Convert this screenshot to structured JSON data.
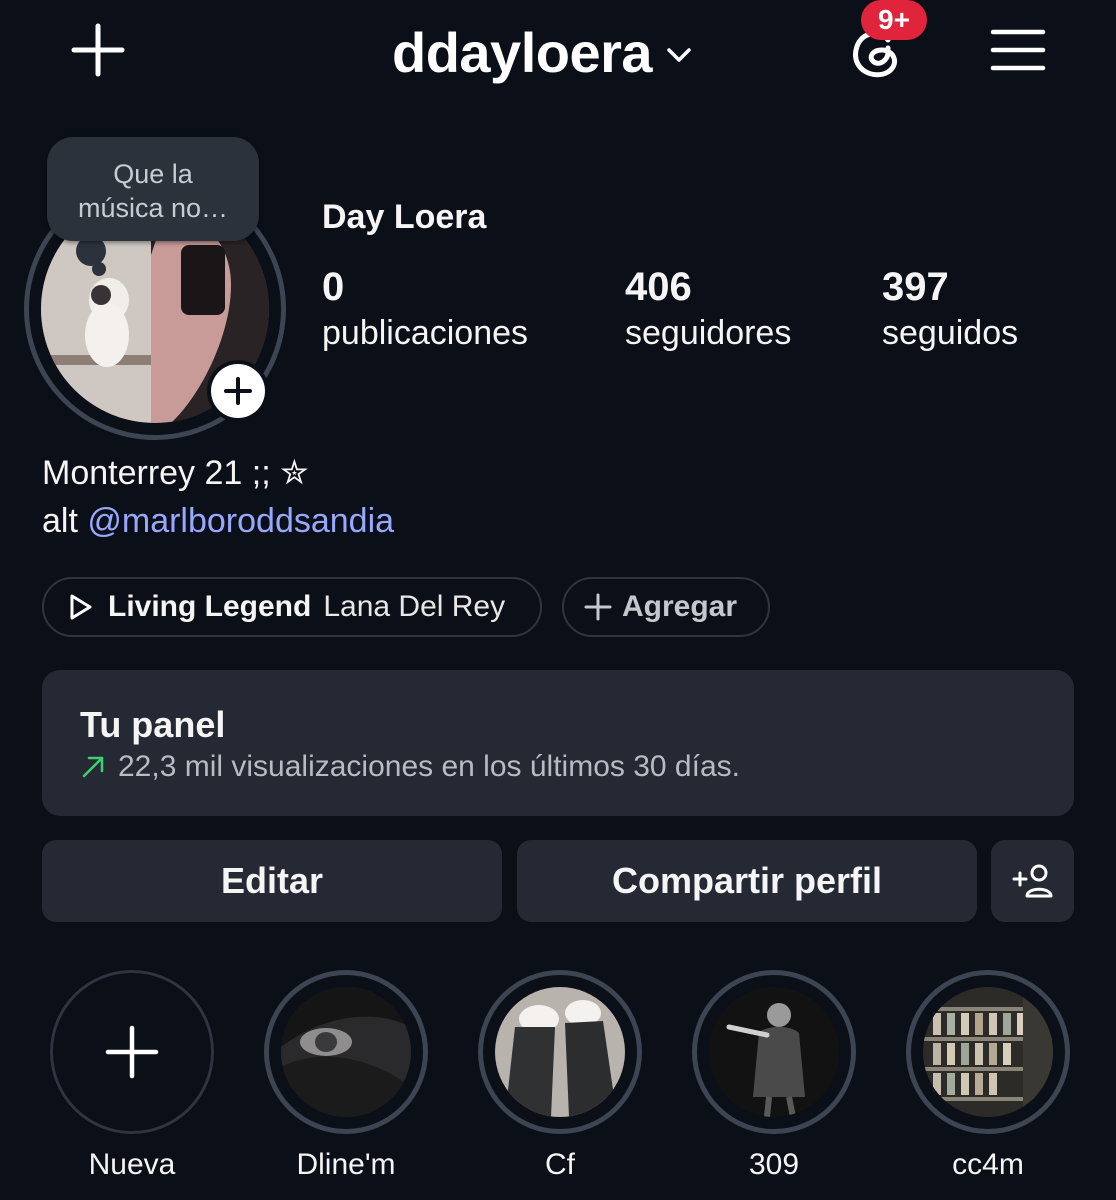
{
  "header": {
    "username": "ddayloera",
    "notification_badge": "9+",
    "icons": [
      "plus-icon",
      "chevron-down-icon",
      "threads-icon",
      "hamburger-menu-icon"
    ]
  },
  "profile": {
    "note": "Que la\nmúsica no…",
    "display_name": "Day Loera",
    "stats": [
      {
        "value": "0",
        "label": "publicaciones"
      },
      {
        "value": "406",
        "label": "seguidores"
      },
      {
        "value": "397",
        "label": "seguidos"
      }
    ],
    "bio_line1": "Monterrey 21 ;; ✮",
    "bio_line2_prefix": "alt ",
    "bio_link": "@marlboroddsandia"
  },
  "music": {
    "song": "Living Legend",
    "artist": "Lana Del Rey",
    "add_label": "Agregar"
  },
  "panel": {
    "title": "Tu panel",
    "subtitle": "22,3 mil visualizaciones en los últimos 30 días."
  },
  "buttons": {
    "edit": "Editar",
    "share": "Compartir perfil"
  },
  "highlights": [
    {
      "label": "Nueva"
    },
    {
      "label": "Dline'm"
    },
    {
      "label": "Cf"
    },
    {
      "label": "309"
    },
    {
      "label": "cc4m"
    }
  ],
  "colors": {
    "background": "#0b0f17",
    "surface": "#242933",
    "link": "#98a8ff",
    "badge": "#e0243c",
    "trend": "#3bd16f"
  }
}
